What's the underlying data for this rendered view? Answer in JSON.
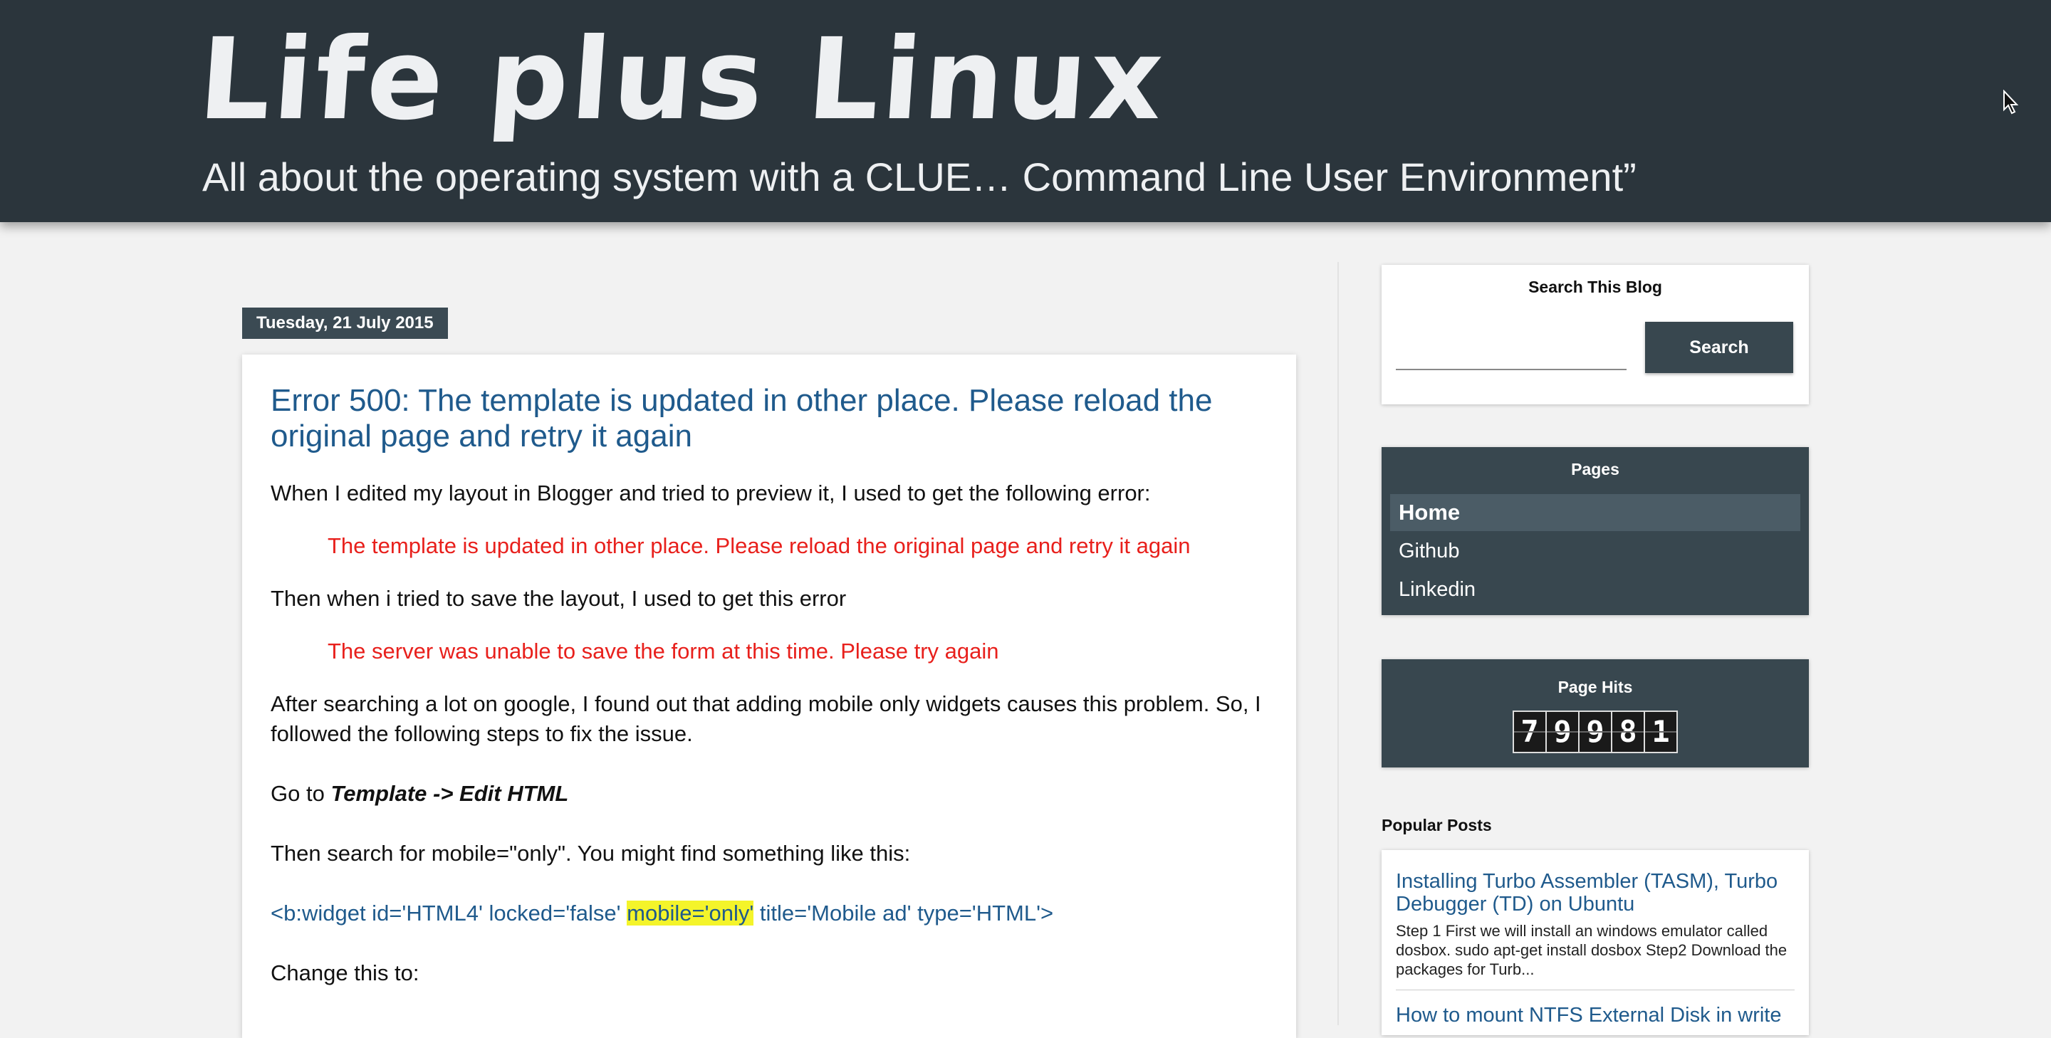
{
  "header": {
    "title": "Life plus Linux",
    "description": "All about the operating system with a CLUE… Command Line User Environment”"
  },
  "post": {
    "date": "Tuesday, 21 July 2015",
    "title": "Error 500: The template is updated in other place. Please reload the original page and retry it again",
    "p1": "When I edited my layout in Blogger and tried to preview it, I used to get the following error:",
    "error1": "The template is updated in other place. Please reload the original page and retry it again",
    "p2": "Then when i tried to save the layout, I used to get this error",
    "error2": "The server was unable to save the form at this time. Please try again",
    "p3": "After searching a lot on google, I found out that adding mobile only widgets causes this problem. So, I followed the following steps to fix the issue.",
    "goto_prefix": "Go to ",
    "goto_path": "Template -> Edit HTML",
    "p4": "Then search for mobile=\"only\". You might find something like this:",
    "code_before": "<b:widget id='HTML4' locked='false' ",
    "code_highlight": "mobile='only'",
    "code_after": " title='Mobile ad' type='HTML'>",
    "p5": "Change this to:"
  },
  "sidebar": {
    "search": {
      "title": "Search This Blog",
      "input_value": "",
      "button_label": "Search"
    },
    "pages": {
      "title": "Pages",
      "items": [
        {
          "label": "Home"
        },
        {
          "label": "Github"
        },
        {
          "label": "Linkedin"
        }
      ]
    },
    "hits": {
      "title": "Page Hits",
      "digits": [
        "7",
        "9",
        "9",
        "8",
        "1"
      ]
    },
    "popular": {
      "heading": "Popular Posts",
      "posts": [
        {
          "title": "Installing Turbo Assembler (TASM), Turbo Debugger (TD) on Ubuntu",
          "snippet": "Step 1 First we will install an windows emulator called dosbox. sudo apt-get install dosbox Step2 Download the packages for  Turb..."
        },
        {
          "title": "How to mount NTFS External Disk in write"
        }
      ]
    }
  },
  "colors": {
    "header_bg": "#2b353c",
    "link_blue": "#1f5a8c",
    "error_red": "#e8201c",
    "widget_dark": "#38474f",
    "highlight": "#f4f42a"
  },
  "icons": {
    "cursor": "mouse-pointer-icon"
  }
}
